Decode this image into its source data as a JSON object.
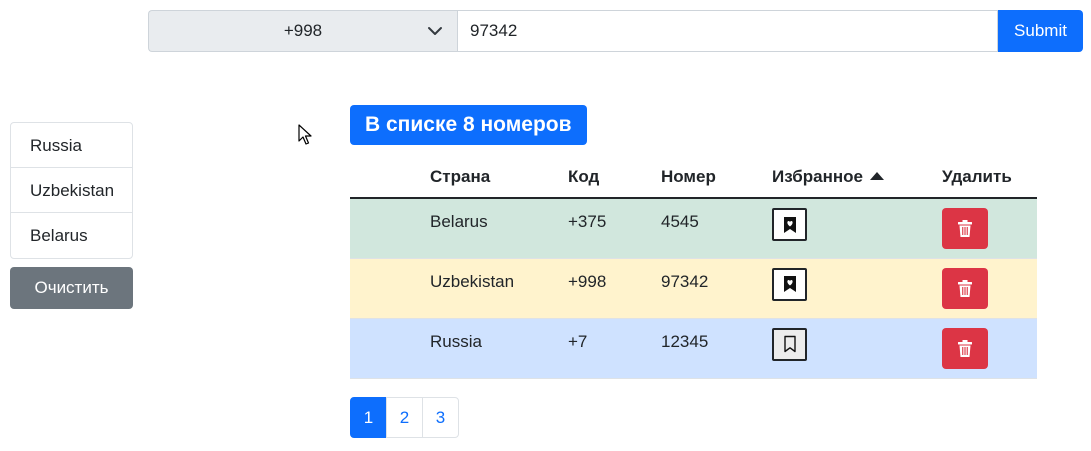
{
  "form": {
    "selected_code": "+998",
    "number_value": "97342",
    "submit_label": "Submit"
  },
  "country_list": {
    "items": [
      "Russia",
      "Uzbekistan",
      "Belarus"
    ],
    "clear_label": "Очистить"
  },
  "badge": {
    "text": "В списке 8 номеров"
  },
  "table": {
    "headers": {
      "country": "Страна",
      "code": "Код",
      "number": "Номер",
      "favorite": "Избранное",
      "delete": "Удалить"
    },
    "sort": {
      "column": "favorite",
      "direction": "descending"
    },
    "rows": [
      {
        "country": "Belarus",
        "code": "+375",
        "number": "4545",
        "favorite": true,
        "status_color": "#d1e7dd"
      },
      {
        "country": "Uzbekistan",
        "code": "+998",
        "number": "97342",
        "favorite": true,
        "status_color": "#fff3cd"
      },
      {
        "country": "Russia",
        "code": "+7",
        "number": "12345",
        "favorite": false,
        "status_color": "#cfe2ff"
      }
    ]
  },
  "pagination": {
    "pages": [
      "1",
      "2",
      "3"
    ],
    "active_page": "1"
  },
  "colors": {
    "primary": "#0d6efd",
    "secondary": "#6c757d",
    "danger": "#dc3545"
  },
  "icons": {
    "select_chevron": "chevron-down-icon",
    "favorite_on": "bookmark-heart-fill-icon",
    "favorite_off": "bookmark-icon",
    "delete": "trash-fill-icon",
    "sort": "caret-up-fill-icon",
    "cursor": "mouse-pointer-icon"
  }
}
